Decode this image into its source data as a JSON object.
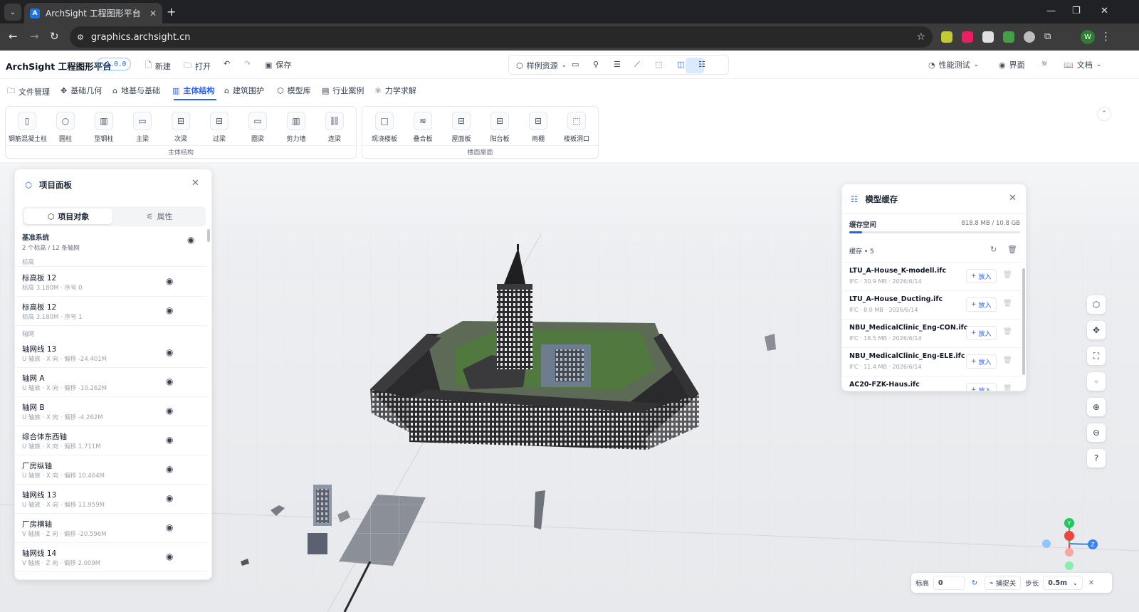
{
  "browser": {
    "tab_title": "ArchSight 工程图形平台",
    "url": "graphics.archsight.cn",
    "profile_initial": "W"
  },
  "app": {
    "title": "ArchSight 工程图形平台",
    "version": "v1.0.0",
    "actions": {
      "new": "新建",
      "open": "打开",
      "save": "保存"
    },
    "center": {
      "sample_resources": "样例资源"
    },
    "right": {
      "perf_test": "性能测试",
      "interface": "界面",
      "docs": "文档"
    }
  },
  "menu_tabs": [
    {
      "label": "文件管理"
    },
    {
      "label": "基础几何"
    },
    {
      "label": "地基与基础"
    },
    {
      "label": "主体结构"
    },
    {
      "label": "建筑围护"
    },
    {
      "label": "模型库"
    },
    {
      "label": "行业案例"
    },
    {
      "label": "力学求解"
    }
  ],
  "ribbon": {
    "main_structure": {
      "title": "主体结构",
      "items": [
        {
          "label": "钢筋混凝土柱"
        },
        {
          "label": "圆柱"
        },
        {
          "label": "型钢柱"
        },
        {
          "label": "主梁"
        },
        {
          "label": "次梁"
        },
        {
          "label": "过梁"
        },
        {
          "label": "圈梁"
        },
        {
          "label": "剪力墙"
        },
        {
          "label": "连梁"
        }
      ]
    },
    "floor_roof": {
      "title": "楼面屋面",
      "items": [
        {
          "label": "现浇楼板"
        },
        {
          "label": "叠合板"
        },
        {
          "label": "屋面板"
        },
        {
          "label": "阳台板"
        },
        {
          "label": "雨棚"
        },
        {
          "label": "楼板洞口"
        }
      ]
    }
  },
  "project_panel": {
    "title": "项目面板",
    "tab_objects": "项目对象",
    "tab_props": "属性",
    "reference": {
      "title": "基准系统",
      "subtitle": "2 个标高 / 12 条轴网"
    },
    "section_levels": "标高",
    "levels": [
      {
        "name": "标高板 12",
        "meta": "标高 3.180M · 序号 0"
      },
      {
        "name": "标高板 12",
        "meta": "标高 3.180M · 序号 1"
      }
    ],
    "section_grids": "轴网",
    "grids": [
      {
        "name": "轴网线 13",
        "meta": "U 轴族 · X 向 · 偏移 -24.401M"
      },
      {
        "name": "轴网 A",
        "meta": "U 轴族 · X 向 · 偏移 -10.262M"
      },
      {
        "name": "轴网 B",
        "meta": "U 轴族 · X 向 · 偏移 -4.262M"
      },
      {
        "name": "综合体东西轴",
        "meta": "U 轴族 · X 向 · 偏移 1.711M"
      },
      {
        "name": "厂房纵轴",
        "meta": "U 轴族 · X 向 · 偏移 10.464M"
      },
      {
        "name": "轴网线 13",
        "meta": "U 轴族 · X 向 · 偏移 11.959M"
      },
      {
        "name": "厂房横轴",
        "meta": "V 轴族 · Z 向 · 偏移 -20.596M"
      },
      {
        "name": "轴网线 14",
        "meta": "V 轴族 · Z 向 · 偏移 2.009M"
      }
    ]
  },
  "cache_panel": {
    "title": "模型缓存",
    "space_label": "缓存空间",
    "space_value": "818.8 MB / 10.8 GB",
    "space_fraction": 0.074,
    "cache_count": "缓存 • 5",
    "load_label": "放入",
    "items": [
      {
        "name": "LTU_A-House_K-modell.ifc",
        "meta": "IFC · 30.9 MB · 2026/6/14"
      },
      {
        "name": "LTU_A-House_Ducting.ifc",
        "meta": "IFC · 8.0 MB · 2026/6/14"
      },
      {
        "name": "NBU_MedicalClinic_Eng-CON.ifc",
        "meta": "IFC · 18.5 MB · 2026/6/14"
      },
      {
        "name": "NBU_MedicalClinic_Eng-ELE.ifc",
        "meta": "IFC · 11.4 MB · 2026/6/14"
      },
      {
        "name": "AC20-FZK-Haus.ifc",
        "meta": ""
      }
    ]
  },
  "gizmo": {
    "y": "Y",
    "z": "Z"
  },
  "bottom_bar": {
    "elevation_label": "标高",
    "elevation_value": "0",
    "snap_label": "捕捉关",
    "step_label": "步长",
    "step_value": "0.5m"
  }
}
